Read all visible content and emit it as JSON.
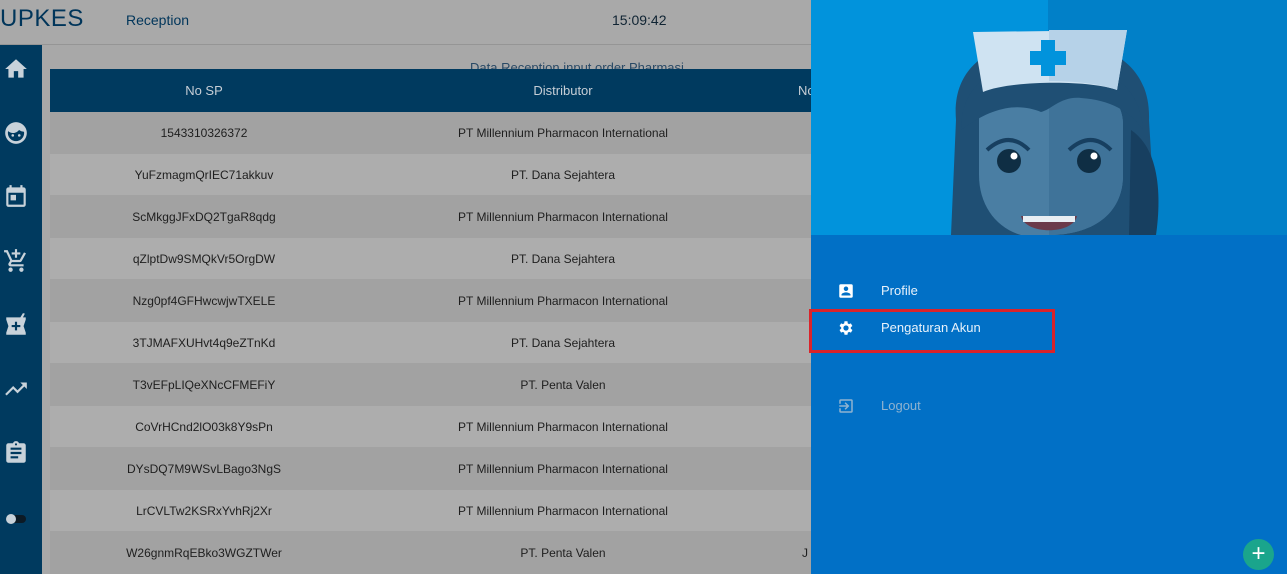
{
  "header": {
    "brand": "UPKES",
    "page_title": "Reception",
    "clock": "15:09:42",
    "banner_text": "Data Reception input order Pharmasi"
  },
  "sidebar": {
    "items": [
      {
        "icon": "home-icon"
      },
      {
        "icon": "baby-face-icon"
      },
      {
        "icon": "calendar-icon"
      },
      {
        "icon": "cart-add-icon"
      },
      {
        "icon": "pharmacy-add-icon"
      },
      {
        "icon": "trending-up-icon"
      },
      {
        "icon": "clipboard-icon"
      },
      {
        "icon": "toggle-icon"
      }
    ]
  },
  "table": {
    "headers": [
      "No SP",
      "Distributor",
      "No"
    ],
    "rows": [
      {
        "no_sp": "1543310326372",
        "distributor": "PT Millennium Pharmacon International",
        "extra": ""
      },
      {
        "no_sp": "YuFzmagmQrIEC71akkuv",
        "distributor": "PT. Dana Sejahtera",
        "extra": ""
      },
      {
        "no_sp": "ScMkggJFxDQ2TgaR8qdg",
        "distributor": "PT Millennium Pharmacon International",
        "extra": ""
      },
      {
        "no_sp": "qZlptDw9SMQkVr5OrgDW",
        "distributor": "PT. Dana Sejahtera",
        "extra": ""
      },
      {
        "no_sp": "Nzg0pf4GFHwcwjwTXELE",
        "distributor": "PT Millennium Pharmacon International",
        "extra": ""
      },
      {
        "no_sp": "3TJMAFXUHvt4q9eZTnKd",
        "distributor": "PT. Dana Sejahtera",
        "extra": ""
      },
      {
        "no_sp": "T3vEFpLIQeXNcCFMEFiY",
        "distributor": "PT. Penta Valen",
        "extra": ""
      },
      {
        "no_sp": "CoVrHCnd2lO03k8Y9sPn",
        "distributor": "PT Millennium Pharmacon International",
        "extra": ""
      },
      {
        "no_sp": "DYsDQ7M9WSvLBago3NgS",
        "distributor": "PT Millennium Pharmacon International",
        "extra": ""
      },
      {
        "no_sp": "LrCVLTw2KSRxYvhRj2Xr",
        "distributor": "PT Millennium Pharmacon International",
        "extra": ""
      },
      {
        "no_sp": "W26gnmRqEBko3WGZTWer",
        "distributor": "PT. Penta Valen",
        "extra": "J"
      }
    ]
  },
  "drawer": {
    "menu": [
      {
        "label": "Profile",
        "icon": "account-box-icon"
      },
      {
        "label": "Pengaturan Akun",
        "icon": "gear-icon"
      },
      {
        "label": "Logout",
        "icon": "exit-icon"
      }
    ]
  },
  "fab": {
    "label": "+"
  },
  "colors": {
    "nav_bg": "#003a5f",
    "drawer_bg": "#0170c6",
    "hero_bg": "#0193dc",
    "highlight": "#d9232a",
    "fab": "#1aa58c"
  }
}
